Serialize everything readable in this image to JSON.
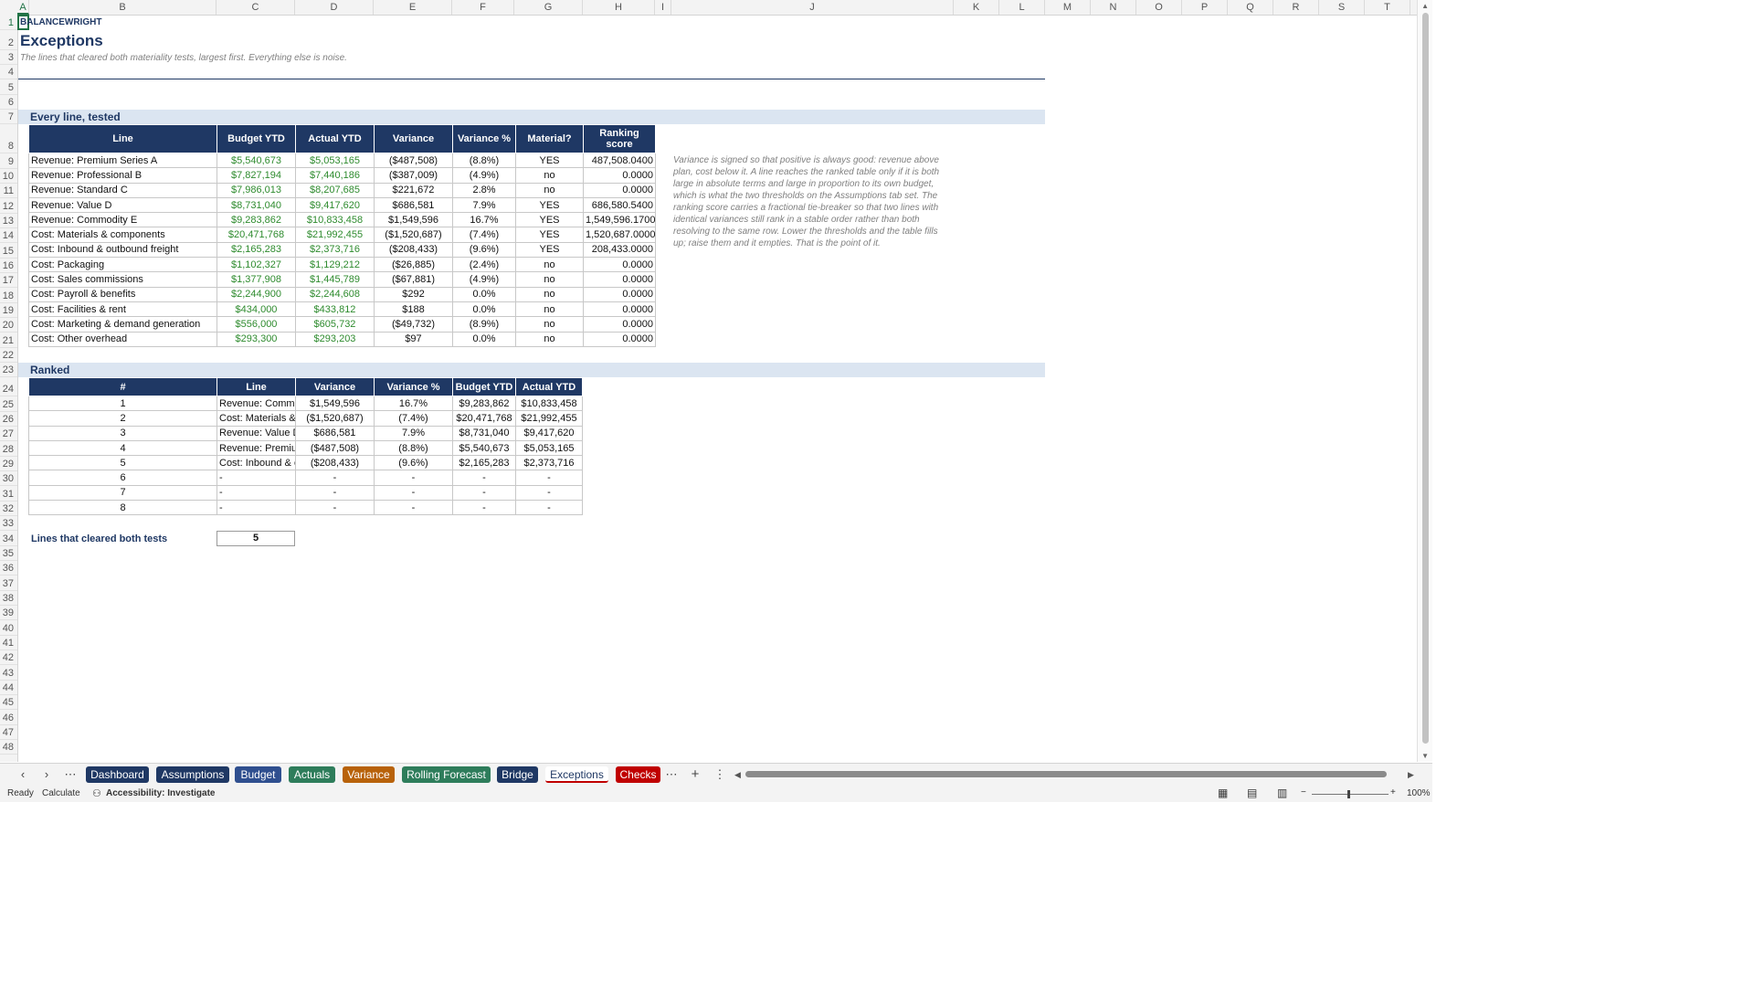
{
  "columns": [
    "A",
    "B",
    "C",
    "D",
    "E",
    "F",
    "G",
    "H",
    "I",
    "J",
    "K",
    "L",
    "M",
    "N",
    "O",
    "P",
    "Q",
    "R",
    "S",
    "T"
  ],
  "rows": [
    "1",
    "2",
    "3",
    "4",
    "5",
    "6",
    "7",
    "8",
    "9",
    "10",
    "11",
    "12",
    "13",
    "14",
    "15",
    "16",
    "17",
    "18",
    "19",
    "20",
    "21",
    "22",
    "23",
    "24",
    "25",
    "26",
    "27",
    "28",
    "29",
    "30",
    "31",
    "32",
    "33",
    "34",
    "35",
    "36",
    "37",
    "38",
    "39",
    "40",
    "41",
    "42",
    "43",
    "44",
    "45",
    "46",
    "47",
    "48"
  ],
  "header": {
    "brand": "BALANCEWRIGHT",
    "title": "Exceptions",
    "subtitle": "The lines that cleared both materiality tests, largest first. Everything else is noise."
  },
  "section1": {
    "label": "Every line, tested",
    "columns": [
      "Line",
      "Budget YTD",
      "Actual YTD",
      "Variance",
      "Variance %",
      "Material?",
      "Ranking score"
    ],
    "rows": [
      [
        "Revenue: Premium Series A",
        "$5,540,673",
        "$5,053,165",
        "($487,508)",
        "(8.8%)",
        "YES",
        "487,508.0400"
      ],
      [
        "Revenue: Professional B",
        "$7,827,194",
        "$7,440,186",
        "($387,009)",
        "(4.9%)",
        "no",
        "0.0000"
      ],
      [
        "Revenue: Standard C",
        "$7,986,013",
        "$8,207,685",
        "$221,672",
        "2.8%",
        "no",
        "0.0000"
      ],
      [
        "Revenue: Value D",
        "$8,731,040",
        "$9,417,620",
        "$686,581",
        "7.9%",
        "YES",
        "686,580.5400"
      ],
      [
        "Revenue: Commodity E",
        "$9,283,862",
        "$10,833,458",
        "$1,549,596",
        "16.7%",
        "YES",
        "1,549,596.1700"
      ],
      [
        "Cost: Materials & components",
        "$20,471,768",
        "$21,992,455",
        "($1,520,687)",
        "(7.4%)",
        "YES",
        "1,520,687.0000"
      ],
      [
        "Cost: Inbound & outbound freight",
        "$2,165,283",
        "$2,373,716",
        "($208,433)",
        "(9.6%)",
        "YES",
        "208,433.0000"
      ],
      [
        "Cost: Packaging",
        "$1,102,327",
        "$1,129,212",
        "($26,885)",
        "(2.4%)",
        "no",
        "0.0000"
      ],
      [
        "Cost: Sales commissions",
        "$1,377,908",
        "$1,445,789",
        "($67,881)",
        "(4.9%)",
        "no",
        "0.0000"
      ],
      [
        "Cost: Payroll & benefits",
        "$2,244,900",
        "$2,244,608",
        "$292",
        "0.0%",
        "no",
        "0.0000"
      ],
      [
        "Cost: Facilities & rent",
        "$434,000",
        "$433,812",
        "$188",
        "0.0%",
        "no",
        "0.0000"
      ],
      [
        "Cost: Marketing & demand generation",
        "$556,000",
        "$605,732",
        "($49,732)",
        "(8.9%)",
        "no",
        "0.0000"
      ],
      [
        "Cost: Other overhead",
        "$293,300",
        "$293,203",
        "$97",
        "0.0%",
        "no",
        "0.0000"
      ]
    ]
  },
  "note": "Variance is signed so that positive is always good: revenue above plan, cost below it. A line reaches the ranked table only if it is both large in absolute terms and large in proportion to its own budget, which is what the two thresholds on the Assumptions tab set. The ranking score carries a fractional tie-breaker so that two lines with identical variances still rank in a stable order rather than both resolving to the same row. Lower the thresholds and the table fills up; raise them and it empties. That is the point of it.",
  "section2": {
    "label": "Ranked",
    "columns": [
      "#",
      "Line",
      "Variance",
      "Variance %",
      "Budget YTD",
      "Actual YTD"
    ],
    "rows": [
      [
        "1",
        "Revenue: Commo",
        "$1,549,596",
        "16.7%",
        "$9,283,862",
        "$10,833,458"
      ],
      [
        "2",
        "Cost: Materials &",
        "($1,520,687)",
        "(7.4%)",
        "$20,471,768",
        "$21,992,455"
      ],
      [
        "3",
        "Revenue: Value D",
        "$686,581",
        "7.9%",
        "$8,731,040",
        "$9,417,620"
      ],
      [
        "4",
        "Revenue: Premiur",
        "($487,508)",
        "(8.8%)",
        "$5,540,673",
        "$5,053,165"
      ],
      [
        "5",
        "Cost: Inbound & c",
        "($208,433)",
        "(9.6%)",
        "$2,165,283",
        "$2,373,716"
      ],
      [
        "6",
        "-",
        "-",
        "-",
        "-",
        "-"
      ],
      [
        "7",
        "-",
        "-",
        "-",
        "-",
        "-"
      ],
      [
        "8",
        "-",
        "-",
        "-",
        "-",
        "-"
      ]
    ]
  },
  "summary": {
    "label": "Lines that cleared both tests",
    "value": "5"
  },
  "tabs": [
    {
      "label": "Dashboard",
      "color": "#1f3864"
    },
    {
      "label": "Assumptions",
      "color": "#1f3864"
    },
    {
      "label": "Budget",
      "color": "#2f4f8f"
    },
    {
      "label": "Actuals",
      "color": "#2e7d5b"
    },
    {
      "label": "Variance",
      "color": "#b8620a"
    },
    {
      "label": "Rolling Forecast",
      "color": "#2e7d5b"
    },
    {
      "label": "Bridge",
      "color": "#1f3864"
    },
    {
      "label": "Exceptions",
      "color": "#ffffff"
    },
    {
      "label": "Checks",
      "color": "#c00000"
    }
  ],
  "active_tab": "Exceptions",
  "status": {
    "ready": "Ready",
    "calculate": "Calculate",
    "accessibility": "Accessibility: Investigate",
    "zoom": "100%"
  }
}
